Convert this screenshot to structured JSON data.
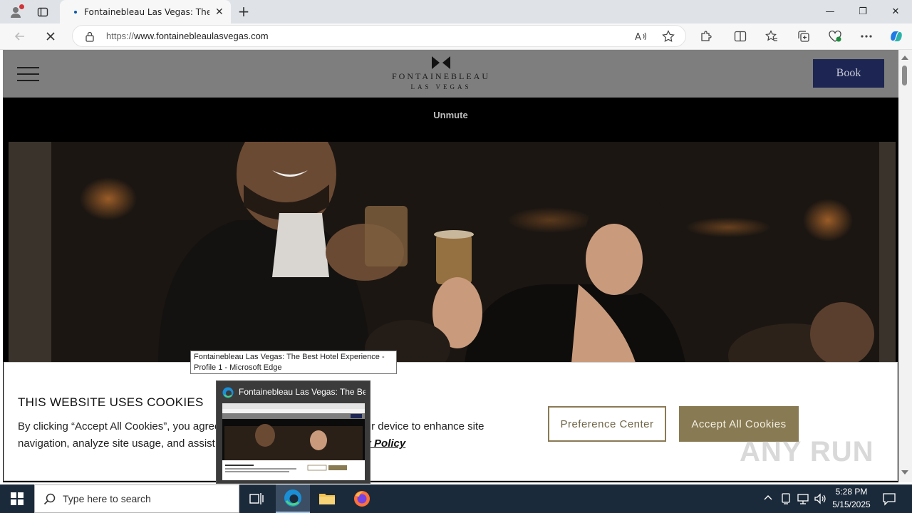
{
  "browser": {
    "tab": {
      "title": "Fontainebleau Las Vegas: The Best Hotel Experience",
      "favicon": "loading-dot"
    },
    "new_tab_symbol": "+",
    "window_controls": {
      "minimize": "—",
      "restore": "❐",
      "close": "✕"
    },
    "address": {
      "scheme": "https://",
      "host": "www.fontainebleaulasvegas.com"
    }
  },
  "site": {
    "brand": "FONTAINEBLEAU",
    "city": "LAS VEGAS",
    "book_label": "Book",
    "unmute_label": "Unmute"
  },
  "cookie": {
    "title": "THIS WEBSITE USES COOKIES",
    "body_start": "By clicking “Accept All Cookies”, you agree to the storing of cookies on your device to enhance site navigation, analyze site usage, and assist in our marketing efforts. ",
    "policy_link": "Privacy Policy",
    "preference_label": "Preference Center",
    "accept_label": "Accept All Cookies"
  },
  "tooltip": {
    "line1": "Fontainebleau Las Vegas: The Best Hotel Experience -",
    "line2": "Profile 1 - Microsoft Edge"
  },
  "thumbnail": {
    "title": "Fontainebleau Las Vegas: The Best Hotel Experience"
  },
  "watermark": "ANY RUN",
  "taskbar": {
    "search_placeholder": "Type here to search",
    "time": "5:28 PM",
    "date": "5/15/2025"
  },
  "colors": {
    "book_button": "#1d2553",
    "accept_button": "#887a52",
    "taskbar": "#1b2a3a"
  }
}
